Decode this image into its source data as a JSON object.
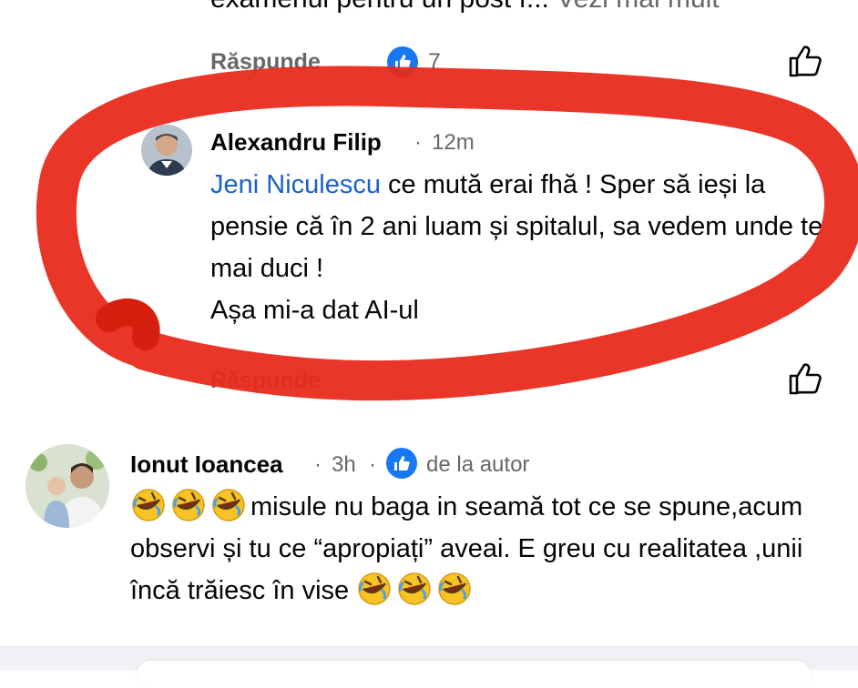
{
  "previous_comment": {
    "truncated_text": "examenul pentru un post î...",
    "see_more": "Vezi mai mult",
    "reply_label": "Răspunde",
    "reaction_count": "7"
  },
  "reply_comment": {
    "author": "Alexandru Filip",
    "time": "12m",
    "mention": "Jeni Niculescu",
    "text_after_mention": " ce mută erai fhă ! Sper să ieși la pensie că în 2 ani luam și spitalul, sa vedem unde te mai duci !",
    "text_line_last": "Așa mi-a dat AI-ul",
    "reply_label": "Răspunde"
  },
  "author_comment": {
    "author": "Ionut Ioancea",
    "time": "3h",
    "author_badge": "de la autor",
    "text_main": "misule nu baga in seamă tot ce se spune,acum observi și tu ce “apropiați” aveai. E greu cu realitatea ,unii încă trăiesc în vise",
    "emoji": "rolling-on-floor-laughing"
  },
  "colors": {
    "accent_blue": "#1877f2",
    "mention_blue": "#1a62c9",
    "secondary_text": "#65676b",
    "annotation_red": "#e8291c"
  }
}
